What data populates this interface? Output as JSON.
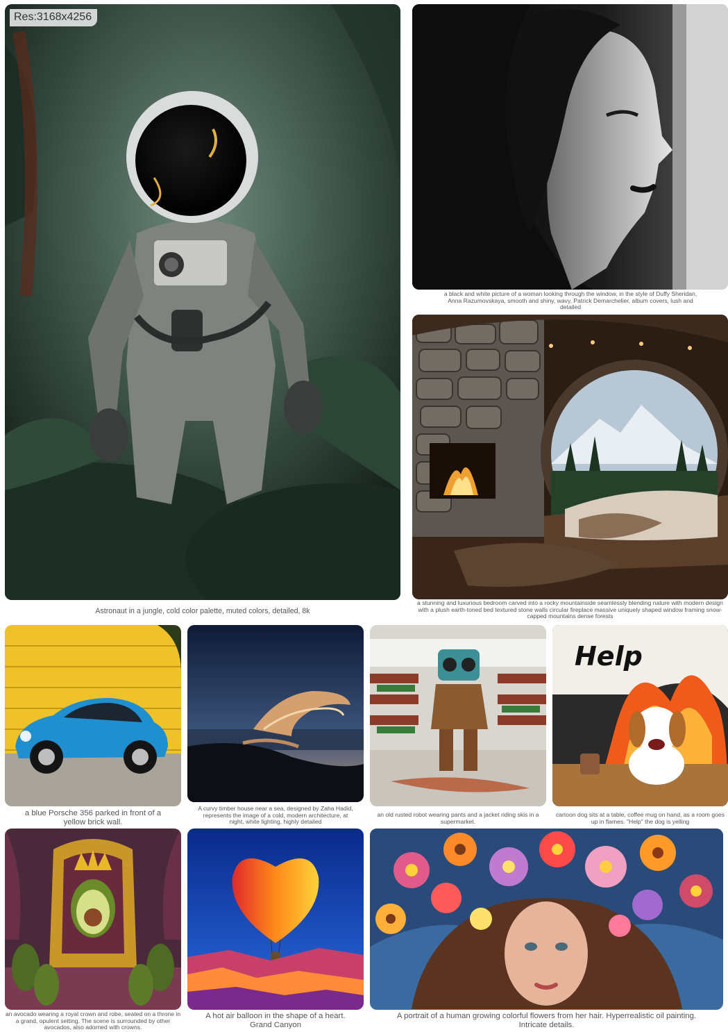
{
  "resolution_badge": "Res:3168x4256",
  "gallery": {
    "astronaut": {
      "caption": "Astronaut in a jungle, cold color palette, muted colors, detailed, 8k"
    },
    "woman": {
      "caption": "a black and white picture of a woman looking through the window, in the style of Duffy Sheridan, Anna Razumovskaya, smooth and shiny, wavy, Patrick Demarchelier, album covers, lush and detailed"
    },
    "bedroom": {
      "caption": "a stunning and luxurious bedroom carved into a rocky mountainside seamlessly blending nature with modern design with a plush earth-toned bed textured stone walls circular fireplace massive uniquely shaped window framing snow-capped mountains dense forests"
    },
    "porsche": {
      "caption": "a blue Porsche 356 parked in front of a yellow brick wall."
    },
    "timber_house": {
      "caption": "A curvy timber house near a sea, designed by Zaha Hadid, represents the image of a cold, modern architecture, at night, white lighting, highly detailed"
    },
    "robot": {
      "caption": "an old rusted robot wearing pants and a jacket riding skis in a supermarket."
    },
    "dog": {
      "caption": "cartoon dog sits at a table, coffee mug on hand, as a room goes up in flames. \"Help\" the dog is yelling",
      "sign_text": "Help"
    },
    "avocado": {
      "caption": "an avocado wearing a royal crown and robe, seated on a throne in a grand, opulent setting. The scene is surrounded by other avocados, also adorned with crowns."
    },
    "balloon": {
      "caption": "A hot air balloon in the shape of a heart. Grand Canyon"
    },
    "flowers": {
      "caption": "A portrait of a human growing colorful flowers from her hair. Hyperrealistic oil painting. Intricate details."
    }
  }
}
